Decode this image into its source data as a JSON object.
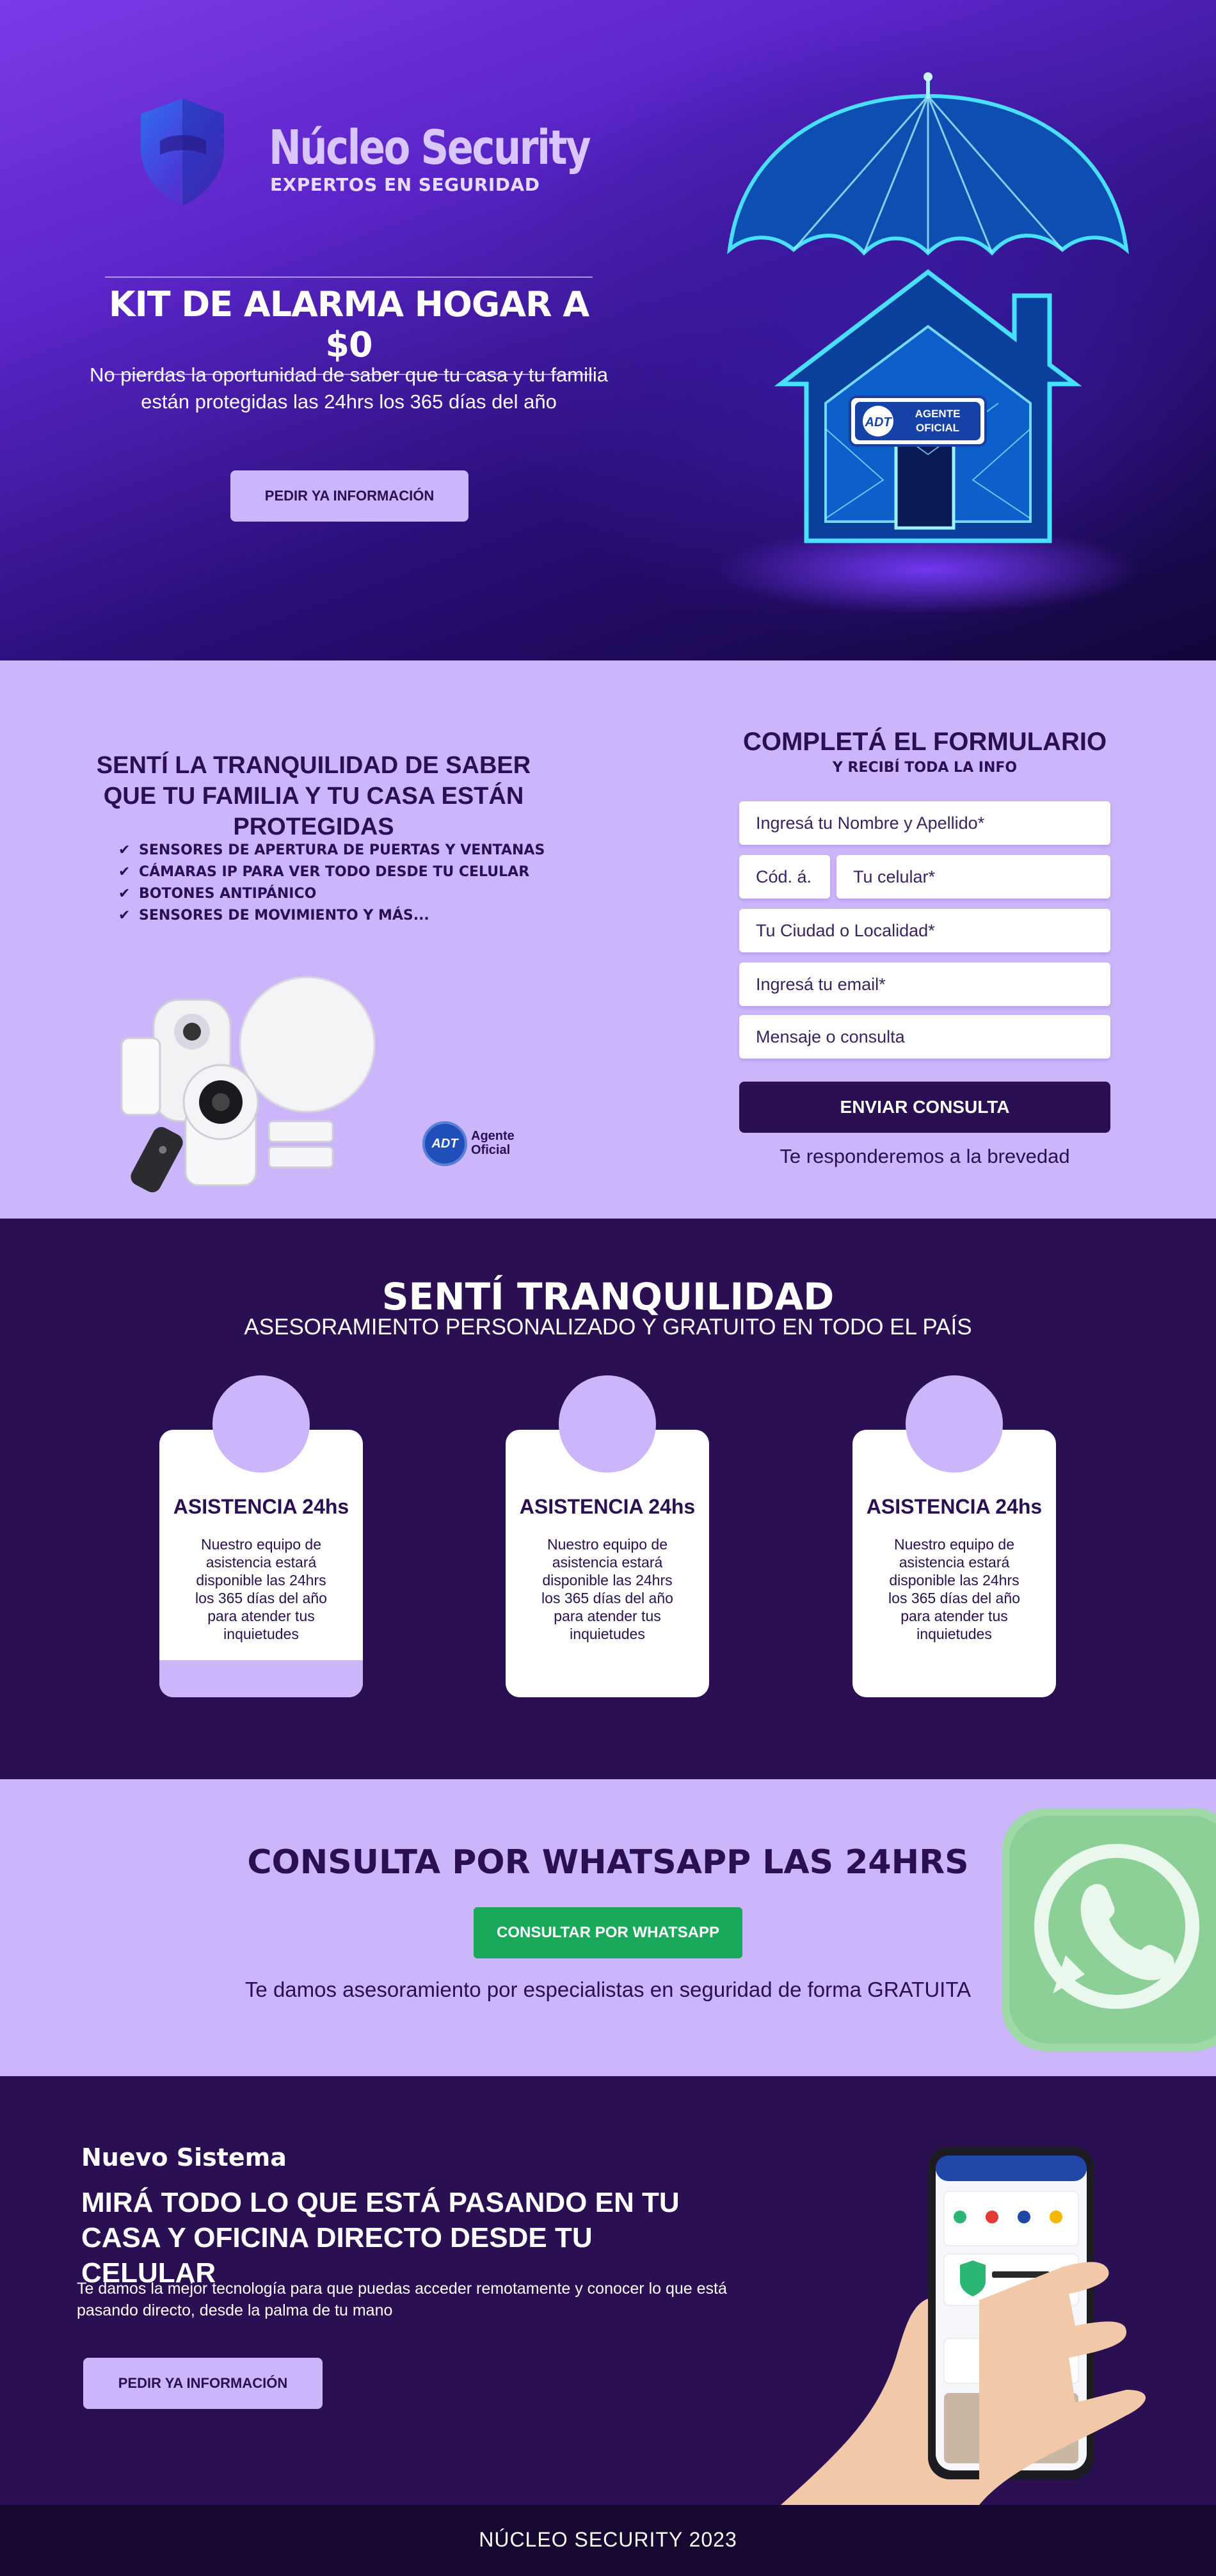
{
  "brand": {
    "name": "Núcleo Security",
    "tagline": "EXPERTOS EN SEGURIDAD"
  },
  "hero": {
    "title": "KIT DE ALARMA HOGAR A $0",
    "subtitle": "No pierdas la oportunidad de saber que tu casa y tu familia están protegidas las 24hrs los 365 días del año",
    "button_label": "PEDIR YA INFORMACIÓN",
    "badge_logo": "ADT",
    "badge_text": "AGENTE OFICIAL"
  },
  "features": {
    "title": "SENTÍ LA TRANQUILIDAD DE SABER QUE TU FAMILIA Y TU CASA ESTÁN PROTEGIDAS",
    "items": [
      "SENSORES DE APERTURA DE PUERTAS Y VENTANAS",
      "CÁMARAS IP PARA VER TODO DESDE TU CELULAR",
      "BOTONES ANTIPÁNICO",
      "SENSORES DE MOVIMIENTO Y MÁS..."
    ],
    "badge_logo": "ADT",
    "badge_line1": "Agente",
    "badge_line2": "Oficial"
  },
  "form": {
    "title": "COMPLETÁ EL FORMULARIO",
    "subtitle": "Y RECIBÍ TODA LA INFO",
    "name_placeholder": "Ingresá tu Nombre y Apellido*",
    "code_placeholder": "Cód. á.",
    "phone_placeholder": "Tu celular*",
    "city_placeholder": "Tu Ciudad o Localidad*",
    "email_placeholder": "Ingresá tu email*",
    "message_placeholder": "Mensaje o consulta",
    "submit_label": "ENVIAR CONSULTA",
    "note": "Te responderemos a la brevedad"
  },
  "tranquilidad": {
    "title": "SENTÍ TRANQUILIDAD",
    "subtitle": "ASESORAMIENTO PERSONALIZADO Y GRATUITO EN TODO EL PAÍS",
    "cards": [
      {
        "title": "ASISTENCIA 24hs",
        "text": "Nuestro equipo de asistencia estará disponible las 24hrs los 365 días del año para atender tus inquietudes"
      },
      {
        "title": "ASISTENCIA 24hs",
        "text": "Nuestro equipo de asistencia estará disponible las 24hrs los 365 días del año para atender tus inquietudes"
      },
      {
        "title": "ASISTENCIA 24hs",
        "text": "Nuestro equipo de asistencia estará disponible las 24hrs los 365 días del año para atender tus inquietudes"
      }
    ]
  },
  "whatsapp": {
    "title": "CONSULTA POR WHATSAPP LAS 24HRS",
    "button_label": "CONSULTAR POR WHATSAPP",
    "note": "Te damos asesoramiento por especialistas en seguridad de forma GRATUITA",
    "icon": "whatsapp-icon"
  },
  "nuevo": {
    "kicker": "Nuevo Sistema",
    "title": "MIRÁ TODO LO QUE ESTÁ PASANDO EN TU CASA Y OFICINA DIRECTO DESDE TU CELULAR",
    "text": "Te damos la mejor tecnología para que puedas acceder remotamente y conocer lo que está pasando directo, desde la palma de tu mano",
    "button_label": "PEDIR YA INFORMACIÓN"
  },
  "footer": {
    "text": "NÚCLEO SECURITY 2023"
  },
  "colors": {
    "primary_dark": "#2a1052",
    "lilac": "#cbb6fb",
    "whatsapp_green": "#19a95a",
    "neon_blue": "#35c8ff"
  }
}
